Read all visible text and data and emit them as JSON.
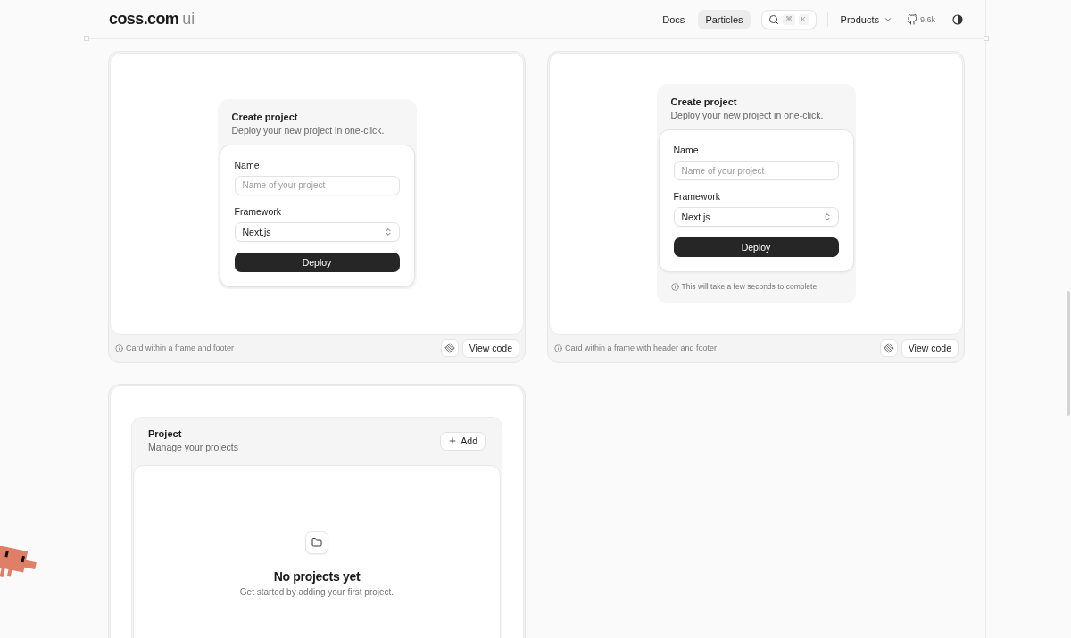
{
  "header": {
    "logo": {
      "name": "coss.com",
      "suffix": "ui"
    },
    "nav": [
      {
        "label": "Docs",
        "selected": false
      },
      {
        "label": "Particles",
        "selected": true
      }
    ],
    "search": {
      "shortcut": [
        "⌘",
        "K"
      ]
    },
    "products": {
      "label": "Products"
    },
    "github": {
      "count": "9.6k"
    }
  },
  "examples": [
    {
      "kind": "form",
      "frame": {
        "title": "Create project",
        "description": "Deploy your new project in one-click.",
        "fields": [
          {
            "kind": "input",
            "label": "Name",
            "placeholder": "Name of your project"
          },
          {
            "kind": "select",
            "label": "Framework",
            "value": "Next.js"
          }
        ],
        "action": "Deploy"
      },
      "caption": "Card within a frame and footer",
      "view_code": "View code"
    },
    {
      "kind": "form",
      "frame": {
        "title": "Create project",
        "description": "Deploy your new project in one-click.",
        "fields": [
          {
            "kind": "input",
            "label": "Name",
            "placeholder": "Name of your project"
          },
          {
            "kind": "select",
            "label": "Framework",
            "value": "Next.js"
          }
        ],
        "action": "Deploy",
        "footer_note": "This will take a few seconds to complete."
      },
      "caption": "Card within a frame with header and footer",
      "view_code": "View code"
    },
    {
      "kind": "empty",
      "frame": {
        "title": "Project",
        "description": "Manage your projects",
        "add_button": "Add",
        "empty_title": "No projects yet",
        "empty_text": "Get started by adding your first project."
      }
    }
  ]
}
